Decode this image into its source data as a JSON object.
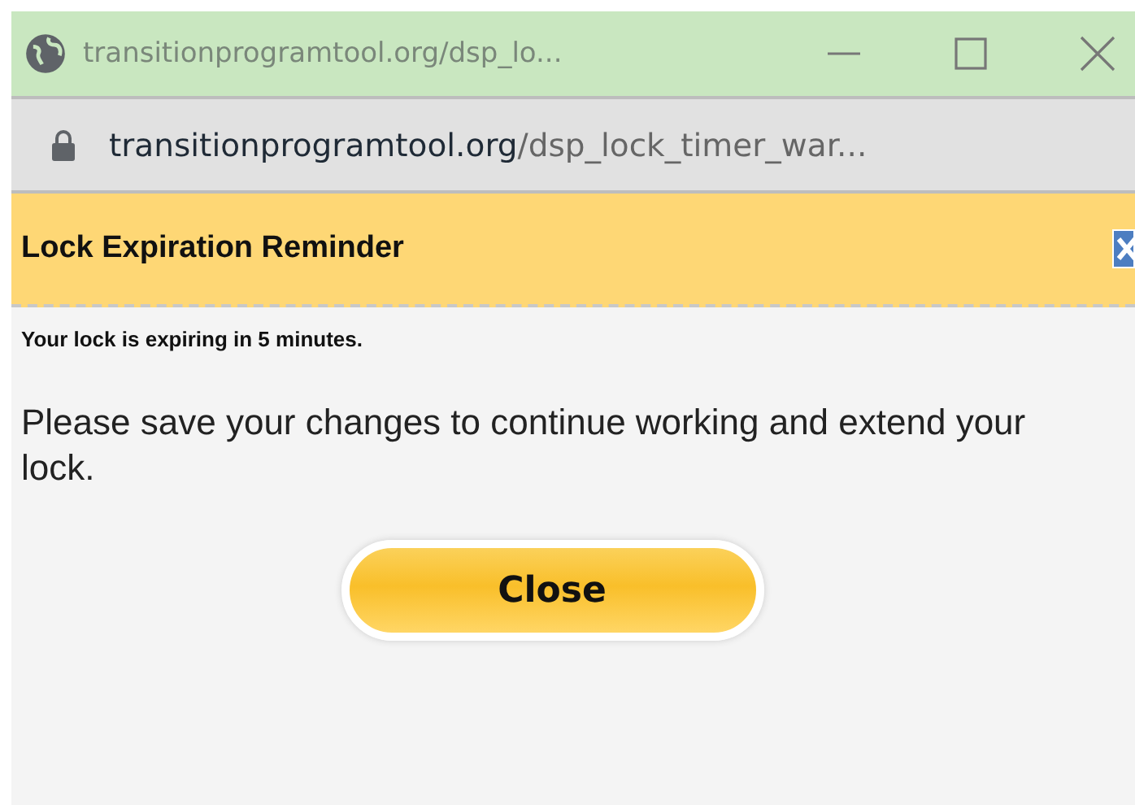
{
  "window": {
    "title": "transitionprogramtool.org/dsp_lo..."
  },
  "address_bar": {
    "domain": "transitionprogramtool.org",
    "path": "/dsp_lock_timer_war..."
  },
  "dialog": {
    "title": "Lock Expiration Reminder",
    "notice": "Your lock is expiring in 5 minutes.",
    "message": "Please save your changes to continue working and extend your lock.",
    "button": "Close"
  }
}
